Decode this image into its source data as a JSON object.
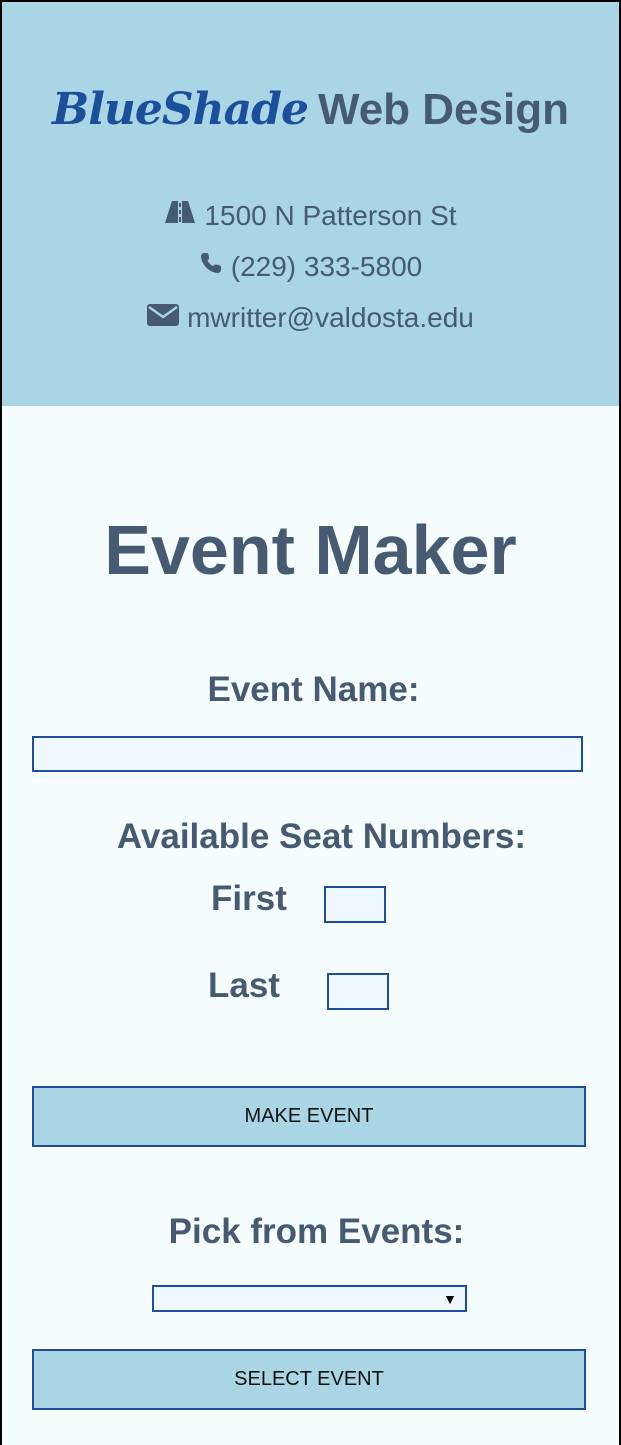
{
  "header": {
    "brand_script": "BlueShade",
    "brand_rest": "Web Design",
    "address": "1500 N Patterson St",
    "phone": "(229) 333-5800",
    "email": "mwritter@valdosta.edu",
    "icons": [
      "road-icon",
      "phone-icon",
      "envelope-icon"
    ]
  },
  "main": {
    "title": "Event Maker",
    "event_name_label": "Event Name:",
    "event_name_value": "",
    "seats_label": "Available Seat Numbers:",
    "first_label": "First",
    "first_value": "",
    "last_label": "Last",
    "last_value": "",
    "make_button": "MAKE EVENT",
    "pick_label": "Pick from Events:",
    "select_value": "",
    "select_button": "SELECT EVENT"
  },
  "colors": {
    "header_bg": "#a9d5e4",
    "page_bg": "#f5fdff",
    "brand_blue": "#1b4f9b",
    "text": "#465a71",
    "border": "#1f4e9a"
  }
}
